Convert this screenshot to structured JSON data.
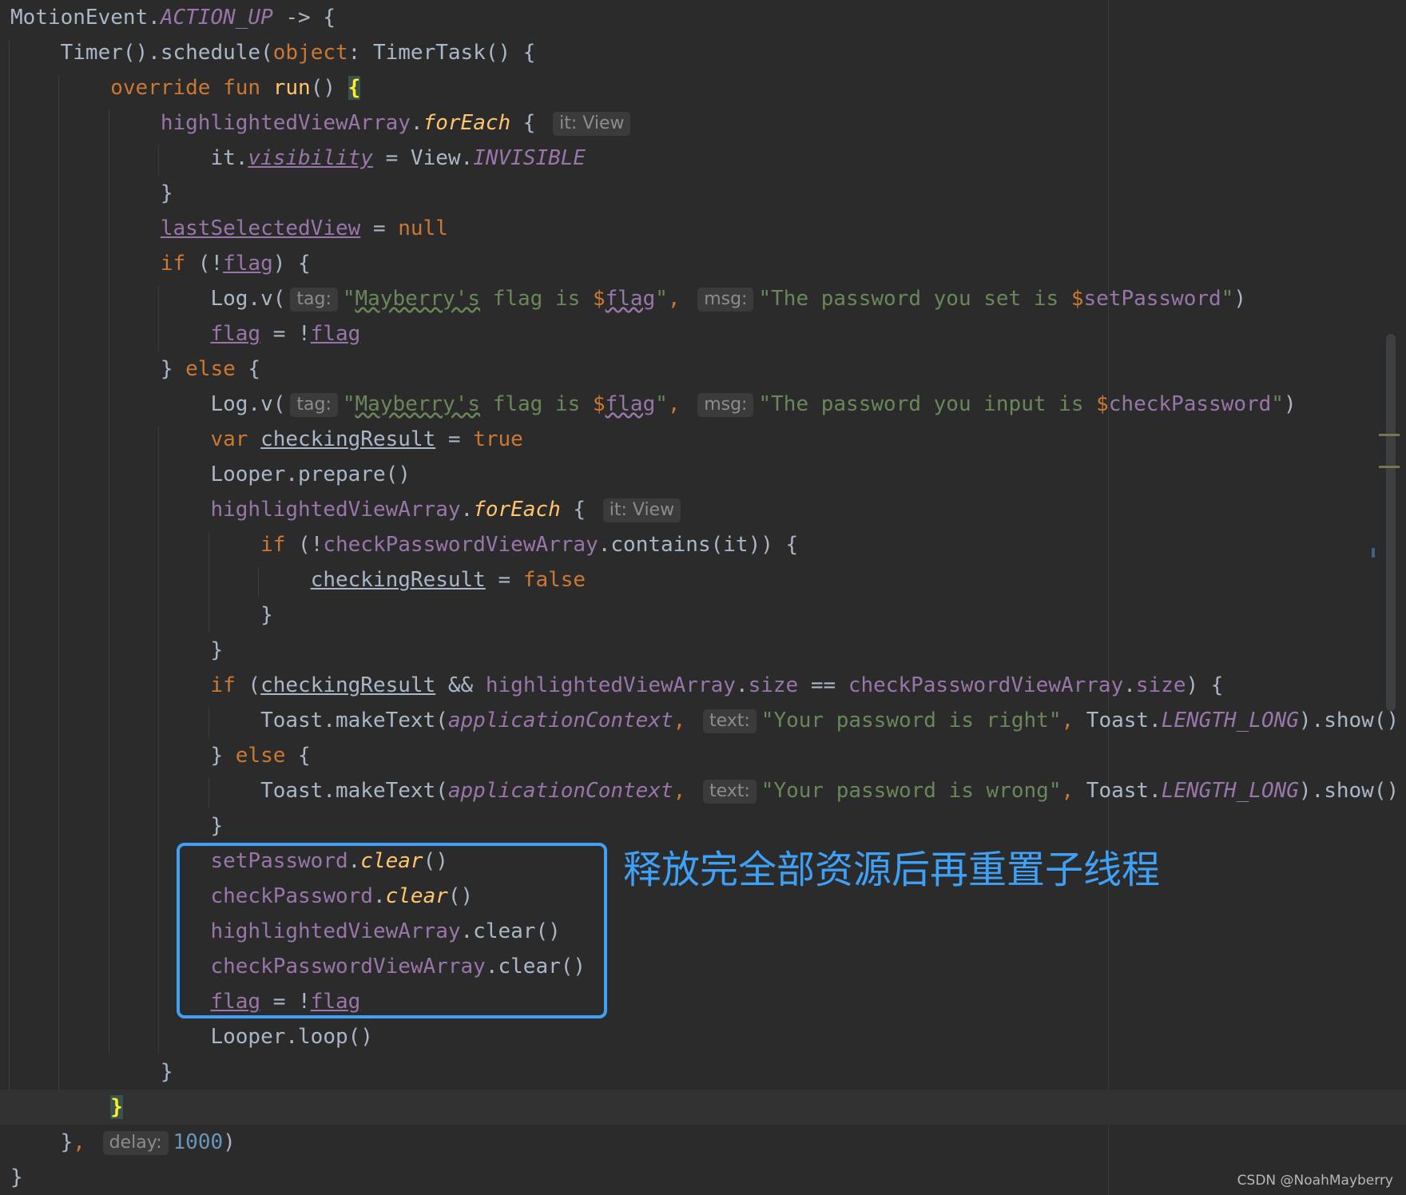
{
  "colors": {
    "background": "#2b2b2b",
    "keyword": "#cc7832",
    "property": "#9876aa",
    "function": "#ffc66d",
    "string": "#6a8759",
    "number": "#6897bb",
    "plain": "#a9b7c6",
    "annotation": "#3ea1f7"
  },
  "annotation": {
    "text": "释放完全部资源后再重置子线程"
  },
  "watermark": "CSDN @NoahMayberry",
  "code": [
    [
      [
        "plain",
        "MotionEvent."
      ],
      [
        "propi",
        "ACTION_UP"
      ],
      [
        "plain",
        " -> {"
      ]
    ],
    [
      [
        "plain",
        "    Timer().schedule("
      ],
      [
        "kw",
        "object"
      ],
      [
        "plain",
        ": TimerTask() {"
      ]
    ],
    [
      [
        "plain",
        "        "
      ],
      [
        "kw",
        "override fun "
      ],
      [
        "fnb",
        "run"
      ],
      [
        "plain",
        "() "
      ],
      [
        "bhl",
        "{"
      ]
    ],
    [
      [
        "plain",
        "            "
      ],
      [
        "prop",
        "highlightedViewArray"
      ],
      [
        "plain",
        "."
      ],
      [
        "fn",
        "forEach"
      ],
      [
        "plain",
        " { "
      ],
      [
        "hint",
        "it: View"
      ]
    ],
    [
      [
        "plain",
        "                it."
      ],
      [
        "propiu",
        "visibility"
      ],
      [
        "plain",
        " = View."
      ],
      [
        "propi",
        "INVISIBLE"
      ]
    ],
    [
      [
        "plain",
        "            }"
      ]
    ],
    [
      [
        "plain",
        "            "
      ],
      [
        "propu",
        "lastSelectedView"
      ],
      [
        "plain",
        " = "
      ],
      [
        "kw",
        "null"
      ]
    ],
    [
      [
        "plain",
        "            "
      ],
      [
        "kw",
        "if"
      ],
      [
        "plain",
        " (!"
      ],
      [
        "propu",
        "flag"
      ],
      [
        "plain",
        ") {"
      ]
    ],
    [
      [
        "plain",
        "                Log.v("
      ],
      [
        "hint",
        "tag:"
      ],
      [
        "str",
        "\""
      ],
      [
        "str_sq",
        "Mayberry's"
      ],
      [
        "str",
        " flag is "
      ],
      [
        "kw",
        "$"
      ],
      [
        "sqp",
        "flag"
      ],
      [
        "str",
        "\""
      ],
      [
        "kw",
        ","
      ],
      [
        "plain",
        " "
      ],
      [
        "hint",
        "msg:"
      ],
      [
        "str",
        "\"The password you set is "
      ],
      [
        "kw",
        "$"
      ],
      [
        "prop",
        "setPassword"
      ],
      [
        "str",
        "\""
      ],
      [
        "plain",
        ")"
      ]
    ],
    [
      [
        "plain",
        "                "
      ],
      [
        "propu",
        "flag"
      ],
      [
        "plain",
        " = !"
      ],
      [
        "propu",
        "flag"
      ]
    ],
    [
      [
        "plain",
        "            } "
      ],
      [
        "kw",
        "else"
      ],
      [
        "plain",
        " {"
      ]
    ],
    [
      [
        "plain",
        "                Log.v("
      ],
      [
        "hint",
        "tag:"
      ],
      [
        "str",
        "\""
      ],
      [
        "str_sq",
        "Mayberry's"
      ],
      [
        "str",
        " flag is "
      ],
      [
        "kw",
        "$"
      ],
      [
        "sqp",
        "flag"
      ],
      [
        "str",
        "\""
      ],
      [
        "kw",
        ","
      ],
      [
        "plain",
        " "
      ],
      [
        "hint",
        "msg:"
      ],
      [
        "str",
        "\"The password you input is "
      ],
      [
        "kw",
        "$"
      ],
      [
        "prop",
        "checkPassword"
      ],
      [
        "str",
        "\""
      ],
      [
        "plain",
        ")"
      ]
    ],
    [
      [
        "plain",
        "                "
      ],
      [
        "kw",
        "var "
      ],
      [
        "varu",
        "checkingResult"
      ],
      [
        "plain",
        " = "
      ],
      [
        "kw",
        "true"
      ]
    ],
    [
      [
        "plain",
        "                Looper.prepare()"
      ]
    ],
    [
      [
        "plain",
        "                "
      ],
      [
        "prop",
        "highlightedViewArray"
      ],
      [
        "plain",
        "."
      ],
      [
        "fn",
        "forEach"
      ],
      [
        "plain",
        " { "
      ],
      [
        "hint",
        "it: View"
      ]
    ],
    [
      [
        "plain",
        "                    "
      ],
      [
        "kw",
        "if"
      ],
      [
        "plain",
        " (!"
      ],
      [
        "prop",
        "checkPasswordViewArray"
      ],
      [
        "plain",
        ".contains(it)) {"
      ]
    ],
    [
      [
        "plain",
        "                        "
      ],
      [
        "varu",
        "checkingResult"
      ],
      [
        "plain",
        " = "
      ],
      [
        "kw",
        "false"
      ]
    ],
    [
      [
        "plain",
        "                    }"
      ]
    ],
    [
      [
        "plain",
        "                }"
      ]
    ],
    [
      [
        "plain",
        "                "
      ],
      [
        "kw",
        "if"
      ],
      [
        "plain",
        " ("
      ],
      [
        "varu",
        "checkingResult"
      ],
      [
        "plain",
        " && "
      ],
      [
        "prop",
        "highlightedViewArray"
      ],
      [
        "plain",
        "."
      ],
      [
        "prop",
        "size"
      ],
      [
        "plain",
        " == "
      ],
      [
        "prop",
        "checkPasswordViewArray"
      ],
      [
        "plain",
        "."
      ],
      [
        "prop",
        "size"
      ],
      [
        "plain",
        ") {"
      ]
    ],
    [
      [
        "plain",
        "                    Toast.makeText("
      ],
      [
        "propi",
        "applicationContext"
      ],
      [
        "kw",
        ","
      ],
      [
        "plain",
        " "
      ],
      [
        "hint",
        "text:"
      ],
      [
        "str",
        "\"Your password is right\""
      ],
      [
        "kw",
        ","
      ],
      [
        "plain",
        " Toast."
      ],
      [
        "propi",
        "LENGTH_LONG"
      ],
      [
        "plain",
        ").show()"
      ]
    ],
    [
      [
        "plain",
        "                } "
      ],
      [
        "kw",
        "else"
      ],
      [
        "plain",
        " {"
      ]
    ],
    [
      [
        "plain",
        "                    Toast.makeText("
      ],
      [
        "propi",
        "applicationContext"
      ],
      [
        "kw",
        ","
      ],
      [
        "plain",
        " "
      ],
      [
        "hint",
        "text:"
      ],
      [
        "str",
        "\"Your password is wrong\""
      ],
      [
        "kw",
        ","
      ],
      [
        "plain",
        " Toast."
      ],
      [
        "propi",
        "LENGTH_LONG"
      ],
      [
        "plain",
        ").show()"
      ]
    ],
    [
      [
        "plain",
        "                }"
      ]
    ],
    [
      [
        "plain",
        "                "
      ],
      [
        "prop",
        "setPassword"
      ],
      [
        "plain",
        "."
      ],
      [
        "fn",
        "clear"
      ],
      [
        "plain",
        "()"
      ]
    ],
    [
      [
        "plain",
        "                "
      ],
      [
        "prop",
        "checkPassword"
      ],
      [
        "plain",
        "."
      ],
      [
        "fn",
        "clear"
      ],
      [
        "plain",
        "()"
      ]
    ],
    [
      [
        "plain",
        "                "
      ],
      [
        "prop",
        "highlightedViewArray"
      ],
      [
        "plain",
        ".clear()"
      ]
    ],
    [
      [
        "plain",
        "                "
      ],
      [
        "prop",
        "checkPasswordViewArray"
      ],
      [
        "plain",
        ".clear()"
      ]
    ],
    [
      [
        "plain",
        "                "
      ],
      [
        "propu",
        "flag"
      ],
      [
        "plain",
        " = !"
      ],
      [
        "propu",
        "flag"
      ]
    ],
    [
      [
        "plain",
        "                Looper.loop()"
      ]
    ],
    [
      [
        "plain",
        "            }"
      ]
    ],
    [
      [
        "plain",
        "        "
      ],
      [
        "bhl",
        "}"
      ]
    ],
    [
      [
        "plain",
        "    }"
      ],
      [
        "kw",
        ","
      ],
      [
        "plain",
        " "
      ],
      [
        "hint",
        "delay:"
      ],
      [
        "num",
        "1000"
      ],
      [
        "plain",
        ")"
      ]
    ],
    [
      [
        "plain",
        "}"
      ]
    ]
  ]
}
